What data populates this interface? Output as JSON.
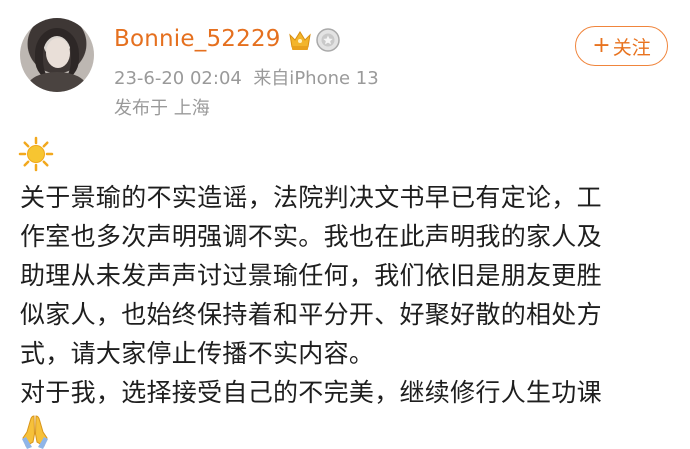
{
  "user": {
    "name": "Bonnie_52229",
    "badges": [
      "crown-icon",
      "medal-icon"
    ],
    "timestamp": "23-6-20 02:04",
    "source": "来自iPhone 13",
    "location": "发布于 上海"
  },
  "follow_button": {
    "plus": "+",
    "label": "关注"
  },
  "colors": {
    "accent": "#e5701f",
    "meta": "#9a9a9a",
    "text": "#1e1e1e"
  },
  "post": {
    "leading_emoji": "sun-icon",
    "lines": [
      "关于景瑜的不实造谣，法院判决文书早已有定论，工",
      "作室也多次声明强调不实。我也在此声明我的家人及",
      "助理从未发声声讨过景瑜任何，我们依旧是朋友更胜",
      "似家人，也始终保持着和平分开、好聚好散的相处方",
      "式，请大家停止传播不实内容。",
      "对于我，选择接受自己的不完美，继续修行人生功课"
    ],
    "trailing_emoji": "pray-icon"
  }
}
